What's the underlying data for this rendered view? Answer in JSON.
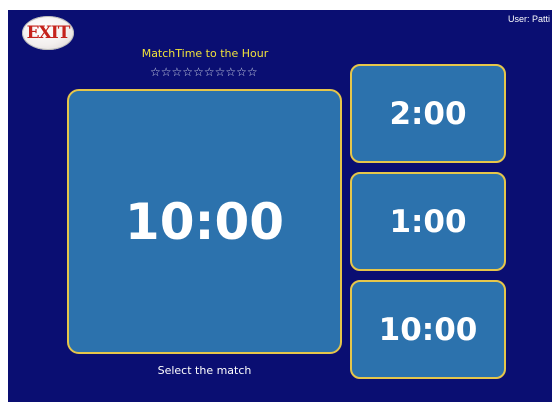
{
  "exit_button": {
    "label": "EXIT"
  },
  "user": {
    "label": "User: Patti"
  },
  "game": {
    "title": "MatchTime to the Hour",
    "stars_total": 10,
    "stars_earned": 0,
    "instruction": "Select the match"
  },
  "target": {
    "time": "10:00"
  },
  "choices": [
    {
      "time": "2:00"
    },
    {
      "time": "1:00"
    },
    {
      "time": "10:00"
    }
  ],
  "colors": {
    "background": "#0a0e72",
    "card_fill": "#2c72ad",
    "card_border": "#e6c64a",
    "title_text": "#f1e23a",
    "exit_text": "#c5221b"
  }
}
